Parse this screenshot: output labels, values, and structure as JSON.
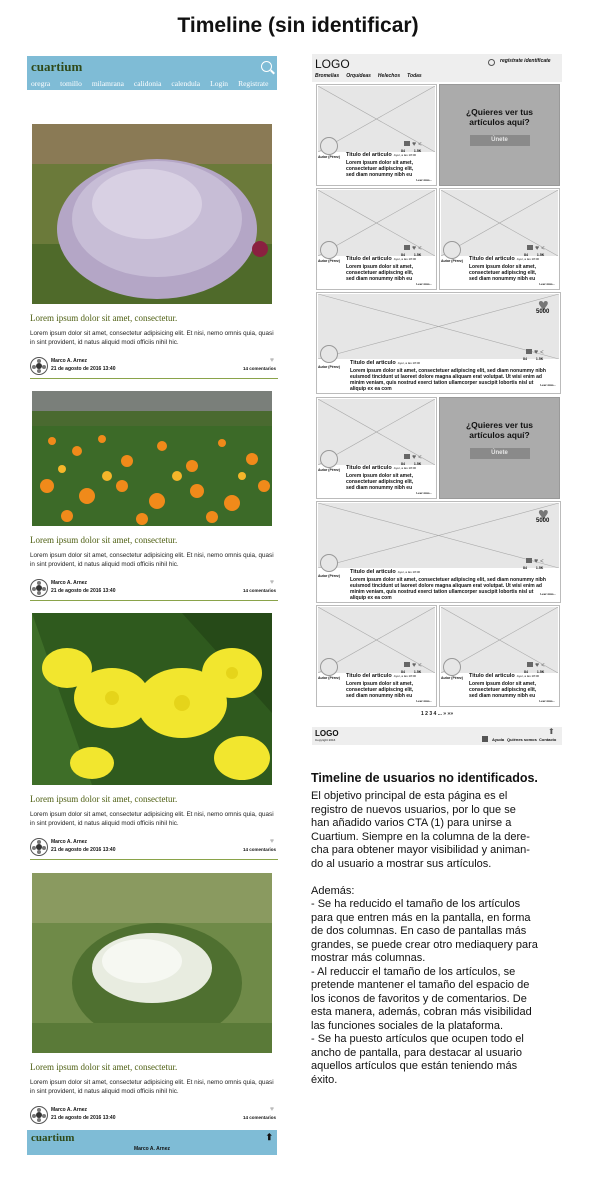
{
  "page_title": "Timeline (sin identificar)",
  "mobile": {
    "logo": "cuartium",
    "nav": [
      "oregra",
      "tomillo",
      "milamrana",
      "calidonia",
      "calendula",
      "Login",
      "Registrate"
    ],
    "articles": [
      {
        "image": "lavender-bush",
        "title": "Lorem ipsum dolor sit amet, consectetur.",
        "text": "Lorem ipsum dolor sit amet, consectetur adipisicing elit. Et nisi, nemo omnis quia, quasi in sint provident, id natus aliquid modi officiis nihil hic.",
        "author": "Marco A. Arnez",
        "date": "21 de agosto de 2016 13:40",
        "comments": "14 comentarios"
      },
      {
        "image": "calendula-field",
        "title": "Lorem ipsum dolor sit amet, consectetur.",
        "text": "Lorem ipsum dolor sit amet, consectetur adipisicing elit. Et nisi, nemo omnis quia, quasi in sint provident, id natus aliquid modi officiis nihil hic.",
        "author": "Marco A. Arnez",
        "date": "21 de agosto de 2016 13:40",
        "comments": "14 comentarios"
      },
      {
        "image": "yellow-flowers",
        "title": "Lorem ipsum dolor sit amet, consectetur.",
        "text": "Lorem ipsum dolor sit amet, consectetur adipisicing elit. Et nisi, nemo omnis quia, quasi in sint provident, id natus aliquid modi officiis nihil hic.",
        "author": "Marco A. Arnez",
        "date": "21 de agosto de 2016 13:40",
        "comments": "14 comentarios"
      },
      {
        "image": "white-yarrow",
        "title": "Lorem ipsum dolor sit amet, consectetur.",
        "text": "Lorem ipsum dolor sit amet, consectetur adipisicing elit. Et nisi, nemo omnis quia, quasi in sint provident, id natus aliquid modi officiis nihil hic.",
        "author": "Marco A. Arnez",
        "date": "21 de agosto de 2016 13:40",
        "comments": "14 comentarios"
      }
    ],
    "footer_logo": "cuartium",
    "footer_author": "Marco A. Arnez"
  },
  "wireframe": {
    "logo": "LOGO",
    "nav": [
      "Bromelias",
      "Orquídeas",
      "Helechos",
      "Todas"
    ],
    "auth": "regístrate  identifícate",
    "card": {
      "title": "Titulo del articulo",
      "meta": "Ayer, a las 18:00",
      "text": "Lorem ipsum dolor sit amet, consectetuer adipiscing elit, sed diam nonummy nibh eu",
      "wide_text": "Lorem ipsum dolor sit amet, consectetuer adipiscing elit, sed diam nonummy nibh euismod tincidunt ut laoreet dolore magna aliquam erat volutpat. Ut wisi enim ad minim veniam, quis nostrud exerci tation ullamcorper suscipit lobortis nisl ut aliquip ex ea com",
      "author": "Autor (Pérez)",
      "read_more": "Leer más...",
      "count_a": "84",
      "count_b": "1.5K",
      "badge": "5000"
    },
    "cta": {
      "question": "¿Quieres ver tus artículos aquí?",
      "button": "Únete"
    },
    "pagination": "1 2 3 4 ... »  »»",
    "footer_logo": "LOGO",
    "footer_copy": "Copyright 2016",
    "footer_links": [
      "Ayuda",
      "Quiénes somos",
      "Contacto"
    ]
  },
  "description": {
    "title": "Timeline de usuarios no identificados.",
    "body": "El objetivo principal de esta página es el\nregistro de nuevos usuarios, por lo que se\nhan añadido varios CTA (1) para unirse a\nCuartium. Siempre en la columna de la dere-\ncha para obtener mayor visibilidad y animan-\ndo al usuario a mostrar sus artículos.\n\nAdemás:\n- Se ha reducido el tamaño de los artículos\npara que entren más en la pantalla, en forma\nde dos columnas. En caso de pantallas más\ngrandes, se puede crear otro mediaquery para\nmostrar más columnas.\n- Al reduccir el tamaño de los artículos, se\npretende mantener el tamaño del espacio de\nlos iconos de favoritos y de comentarios. De\nesta manera, además, cobran más visibilidad\nlas funciones sociales de la plataforma.\n- Se ha puesto artículos que ocupen todo el\nancho de pantalla, para destacar al usuario\naquellos artículos que están teniendo más\néxito."
  },
  "colors": {
    "header_blue": "#7fbcd6",
    "title_green": "#4e5f12",
    "wire_gray": "#e6e6e6",
    "cta_gray": "#ababab"
  }
}
